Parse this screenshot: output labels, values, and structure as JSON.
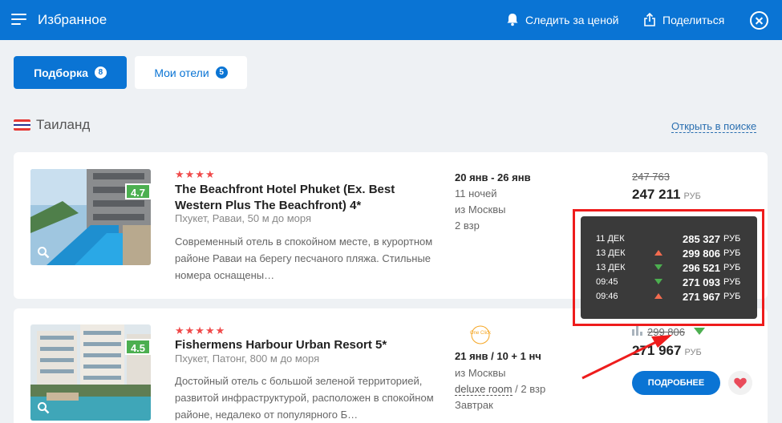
{
  "header": {
    "title": "Избранное",
    "watch_price_label": "Следить за ценой",
    "share_label": "Поделиться"
  },
  "tabs": [
    {
      "label": "Подборка",
      "count": "8",
      "active": true
    },
    {
      "label": "Мои отели",
      "count": "5",
      "active": false
    }
  ],
  "country": {
    "name": "Таиланд",
    "open_search_label": "Открыть в поиске"
  },
  "hotels": [
    {
      "stars": "★★★★",
      "rating": "4.7",
      "name": "The Beachfront Hotel Phuket (Ex. Best Western Plus The Beachfront) 4*",
      "location": "Пхукет, Раваи, 50 м до моря",
      "description": "Современный отель в спокойном месте, в курортном районе Раваи на берегу песчаного пляжа. Стильные номера оснащены…",
      "dates": "20 янв - 26 янв",
      "nights": "11 ночей",
      "from": "из Москвы",
      "guests": "2 взр",
      "old_price": "247 763",
      "price": "247 211",
      "currency": "РУБ"
    },
    {
      "stars": "★★★★★",
      "rating": "4.5",
      "name": "Fishermens Harbour Urban Resort 5*",
      "location": "Пхукет, Патонг, 800 м до моря",
      "description": "Достойный отель с большой зеленой территорией, развитой инфраструктурой, расположен в спокойном районе, недалеко от популярного Б…",
      "partner": "One Click",
      "dates": "21 янв / 10 + 1 нч",
      "from": "из Москвы",
      "room": "deluxe room",
      "guests": "/ 2 взр",
      "meal": "Завтрак",
      "old_price": "299 806",
      "price": "271 967",
      "currency": "РУБ",
      "more_label": "ПОДРОБНЕЕ"
    }
  ],
  "price_history": [
    {
      "label": "11 ДЕК",
      "trend": "none",
      "value": "285 327",
      "currency": "РУБ"
    },
    {
      "label": "13 ДЕК",
      "trend": "up",
      "value": "299 806",
      "currency": "РУБ"
    },
    {
      "label": "13 ДЕК",
      "trend": "down",
      "value": "296 521",
      "currency": "РУБ"
    },
    {
      "label": "09:45",
      "trend": "down",
      "value": "271 093",
      "currency": "РУБ"
    },
    {
      "label": "09:46",
      "trend": "up",
      "value": "271 967",
      "currency": "РУБ"
    }
  ],
  "colors": {
    "brand": "#0a74d4",
    "rating": "#4caf50",
    "stars": "#f04a4a",
    "up": "#f26b4f",
    "down": "#4caf50",
    "highlight": "#ee1c1c"
  }
}
